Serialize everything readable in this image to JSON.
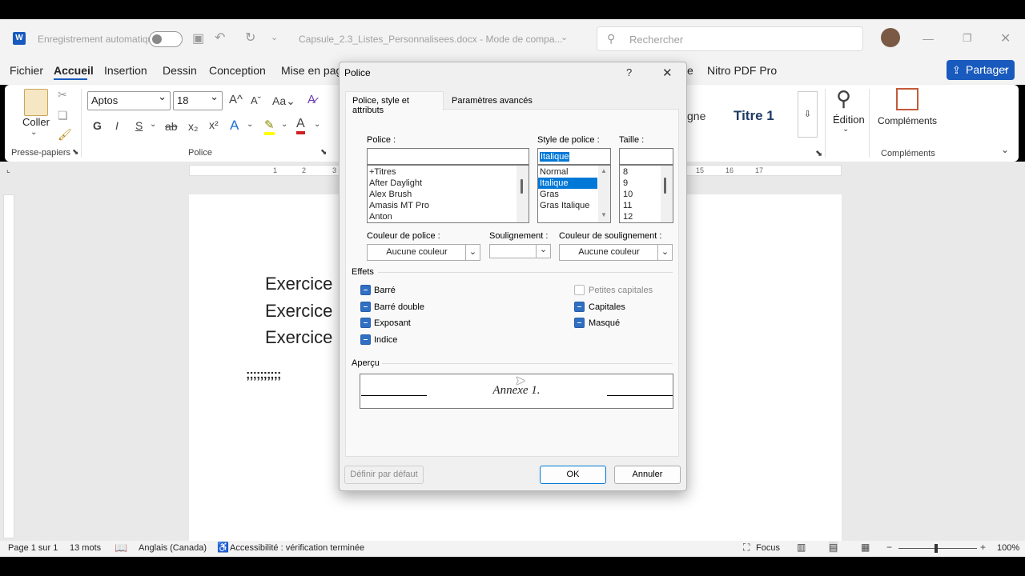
{
  "titlebar": {
    "autosave_label": "Enregistrement automatique",
    "document_title": "Capsule_2.3_Listes_Personnalisees.docx  -  Mode de compa...",
    "search_placeholder": "Rechercher"
  },
  "tabs": [
    "Fichier",
    "Accueil",
    "Insertion",
    "Dessin",
    "Conception",
    "Mise en page"
  ],
  "tabs_right": [
    "Nitro PDF Pro"
  ],
  "share_label": "Partager",
  "ribbon": {
    "paste_label": "Coller",
    "clipboard_group": "Presse-papiers",
    "font_name": "Aptos",
    "font_size": "18",
    "font_group": "Police",
    "bold": "G",
    "italic": "I",
    "underline": "S",
    "styles_partial": "gne",
    "style_title1": "Titre 1",
    "editing_label": "Édition",
    "addins_label": "Compléments",
    "addins_group": "Compléments"
  },
  "ruler": {
    "left_numbers": [
      "1",
      "2",
      "3"
    ],
    "right_numbers": [
      "15",
      "16",
      "17"
    ]
  },
  "document": {
    "lines": [
      "Exercice",
      "Exercice",
      "Exercice"
    ],
    "semicolons": ";;;;;;;;;;"
  },
  "status": {
    "page": "Page 1 sur 1",
    "words": "13 mots",
    "language": "Anglais (Canada)",
    "accessibility": "Accessibilité : vérification terminée",
    "focus": "Focus",
    "zoom": "100%"
  },
  "dialog": {
    "title": "Police",
    "help": "?",
    "tabs": [
      "Police, style et attributs",
      "Paramètres avancés"
    ],
    "font_label": "Police :",
    "font_value": "",
    "font_list": [
      "+Titres",
      "After Daylight",
      "Alex Brush",
      "Amasis MT Pro",
      "Anton"
    ],
    "style_label": "Style de police :",
    "style_value": "Italique",
    "style_list": [
      "Normal",
      "Italique",
      "Gras",
      "Gras Italique"
    ],
    "style_selected_index": 1,
    "size_label": "Taille :",
    "size_value": "",
    "size_list": [
      "8",
      "9",
      "10",
      "11",
      "12"
    ],
    "font_color_label": "Couleur de police :",
    "font_color_value": "Aucune couleur",
    "underline_label": "Soulignement :",
    "underline_value": "",
    "underline_color_label": "Couleur de soulignement :",
    "underline_color_value": "Aucune couleur",
    "effects_label": "Effets",
    "effects_left": [
      {
        "label": "Barré",
        "state": "mixed"
      },
      {
        "label": "Barré double",
        "state": "mixed"
      },
      {
        "label": "Exposant",
        "state": "mixed"
      },
      {
        "label": "Indice",
        "state": "mixed"
      }
    ],
    "effects_right": [
      {
        "label": "Petites capitales",
        "state": "disabled"
      },
      {
        "label": "Capitales",
        "state": "mixed"
      },
      {
        "label": "Masqué",
        "state": "mixed"
      }
    ],
    "preview_label": "Aperçu",
    "preview_text": "Annexe 1.",
    "default_button": "Définir par défaut",
    "ok_button": "OK",
    "cancel_button": "Annuler"
  }
}
